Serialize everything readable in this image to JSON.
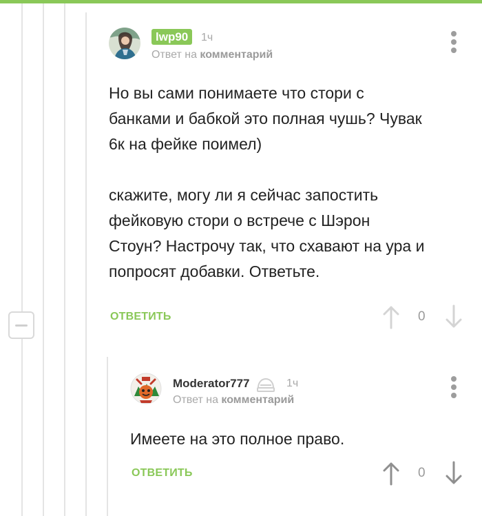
{
  "colors": {
    "accent": "#8ac858",
    "muted": "#a8a8a8",
    "line": "#e4e4e4"
  },
  "comment1": {
    "username": "lwp90",
    "time": "1ч",
    "reply_prefix": "Ответ на ",
    "reply_target": "комментарий",
    "text": "Но вы сами понимаете что стори с\nбанками и бабкой это полная чушь? Чувак\n6к на фейке поимел)\n\nскажите, могу ли я сейчас запостить\nфейковую стори о встрече с Шэрон\nСтоун? Настрочу так, что схавают на ура и\nпопросят добавки. Ответьте.",
    "reply_label": "ОТВЕТИТЬ",
    "score": "0"
  },
  "comment2": {
    "username": "Moderator777",
    "time": "1ч",
    "reply_prefix": "Ответ на ",
    "reply_target": "комментарий",
    "text": "Имеете на это полное право.",
    "reply_label": "ОТВЕТИТЬ",
    "score": "0"
  }
}
